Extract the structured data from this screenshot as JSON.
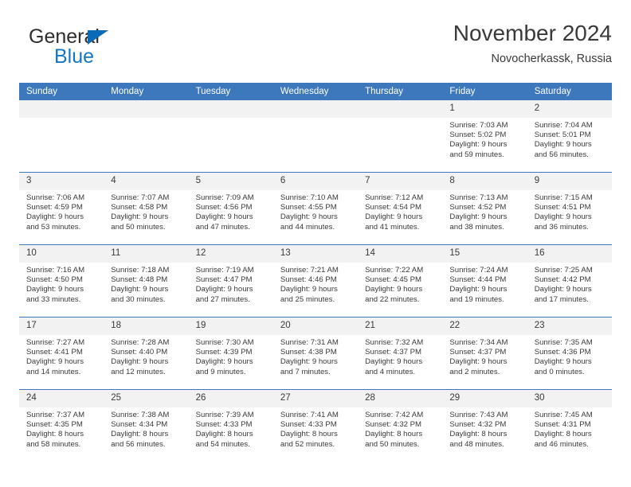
{
  "brand": {
    "line1": "General",
    "line2": "Blue",
    "triangle_color": "#0a6ab5",
    "text_color": "#2e2e2e",
    "accent_color": "#1577c4"
  },
  "header": {
    "title": "November 2024",
    "subtitle": "Novocherkassk, Russia"
  },
  "theme": {
    "header_bg": "#3d77bc",
    "header_text": "#ffffff",
    "daynum_bg": "#f2f2f2",
    "cell_bg": "#ffffff",
    "text": "#3a3a3a"
  },
  "weekdays": [
    "Sunday",
    "Monday",
    "Tuesday",
    "Wednesday",
    "Thursday",
    "Friday",
    "Saturday"
  ],
  "weeks": [
    [
      {
        "empty": true
      },
      {
        "empty": true
      },
      {
        "empty": true
      },
      {
        "empty": true
      },
      {
        "empty": true
      },
      {
        "day": "1",
        "sunrise": "Sunrise: 7:03 AM",
        "sunset": "Sunset: 5:02 PM",
        "daylight1": "Daylight: 9 hours",
        "daylight2": "and 59 minutes."
      },
      {
        "day": "2",
        "sunrise": "Sunrise: 7:04 AM",
        "sunset": "Sunset: 5:01 PM",
        "daylight1": "Daylight: 9 hours",
        "daylight2": "and 56 minutes."
      }
    ],
    [
      {
        "day": "3",
        "sunrise": "Sunrise: 7:06 AM",
        "sunset": "Sunset: 4:59 PM",
        "daylight1": "Daylight: 9 hours",
        "daylight2": "and 53 minutes."
      },
      {
        "day": "4",
        "sunrise": "Sunrise: 7:07 AM",
        "sunset": "Sunset: 4:58 PM",
        "daylight1": "Daylight: 9 hours",
        "daylight2": "and 50 minutes."
      },
      {
        "day": "5",
        "sunrise": "Sunrise: 7:09 AM",
        "sunset": "Sunset: 4:56 PM",
        "daylight1": "Daylight: 9 hours",
        "daylight2": "and 47 minutes."
      },
      {
        "day": "6",
        "sunrise": "Sunrise: 7:10 AM",
        "sunset": "Sunset: 4:55 PM",
        "daylight1": "Daylight: 9 hours",
        "daylight2": "and 44 minutes."
      },
      {
        "day": "7",
        "sunrise": "Sunrise: 7:12 AM",
        "sunset": "Sunset: 4:54 PM",
        "daylight1": "Daylight: 9 hours",
        "daylight2": "and 41 minutes."
      },
      {
        "day": "8",
        "sunrise": "Sunrise: 7:13 AM",
        "sunset": "Sunset: 4:52 PM",
        "daylight1": "Daylight: 9 hours",
        "daylight2": "and 38 minutes."
      },
      {
        "day": "9",
        "sunrise": "Sunrise: 7:15 AM",
        "sunset": "Sunset: 4:51 PM",
        "daylight1": "Daylight: 9 hours",
        "daylight2": "and 36 minutes."
      }
    ],
    [
      {
        "day": "10",
        "sunrise": "Sunrise: 7:16 AM",
        "sunset": "Sunset: 4:50 PM",
        "daylight1": "Daylight: 9 hours",
        "daylight2": "and 33 minutes."
      },
      {
        "day": "11",
        "sunrise": "Sunrise: 7:18 AM",
        "sunset": "Sunset: 4:48 PM",
        "daylight1": "Daylight: 9 hours",
        "daylight2": "and 30 minutes."
      },
      {
        "day": "12",
        "sunrise": "Sunrise: 7:19 AM",
        "sunset": "Sunset: 4:47 PM",
        "daylight1": "Daylight: 9 hours",
        "daylight2": "and 27 minutes."
      },
      {
        "day": "13",
        "sunrise": "Sunrise: 7:21 AM",
        "sunset": "Sunset: 4:46 PM",
        "daylight1": "Daylight: 9 hours",
        "daylight2": "and 25 minutes."
      },
      {
        "day": "14",
        "sunrise": "Sunrise: 7:22 AM",
        "sunset": "Sunset: 4:45 PM",
        "daylight1": "Daylight: 9 hours",
        "daylight2": "and 22 minutes."
      },
      {
        "day": "15",
        "sunrise": "Sunrise: 7:24 AM",
        "sunset": "Sunset: 4:44 PM",
        "daylight1": "Daylight: 9 hours",
        "daylight2": "and 19 minutes."
      },
      {
        "day": "16",
        "sunrise": "Sunrise: 7:25 AM",
        "sunset": "Sunset: 4:42 PM",
        "daylight1": "Daylight: 9 hours",
        "daylight2": "and 17 minutes."
      }
    ],
    [
      {
        "day": "17",
        "sunrise": "Sunrise: 7:27 AM",
        "sunset": "Sunset: 4:41 PM",
        "daylight1": "Daylight: 9 hours",
        "daylight2": "and 14 minutes."
      },
      {
        "day": "18",
        "sunrise": "Sunrise: 7:28 AM",
        "sunset": "Sunset: 4:40 PM",
        "daylight1": "Daylight: 9 hours",
        "daylight2": "and 12 minutes."
      },
      {
        "day": "19",
        "sunrise": "Sunrise: 7:30 AM",
        "sunset": "Sunset: 4:39 PM",
        "daylight1": "Daylight: 9 hours",
        "daylight2": "and 9 minutes."
      },
      {
        "day": "20",
        "sunrise": "Sunrise: 7:31 AM",
        "sunset": "Sunset: 4:38 PM",
        "daylight1": "Daylight: 9 hours",
        "daylight2": "and 7 minutes."
      },
      {
        "day": "21",
        "sunrise": "Sunrise: 7:32 AM",
        "sunset": "Sunset: 4:37 PM",
        "daylight1": "Daylight: 9 hours",
        "daylight2": "and 4 minutes."
      },
      {
        "day": "22",
        "sunrise": "Sunrise: 7:34 AM",
        "sunset": "Sunset: 4:37 PM",
        "daylight1": "Daylight: 9 hours",
        "daylight2": "and 2 minutes."
      },
      {
        "day": "23",
        "sunrise": "Sunrise: 7:35 AM",
        "sunset": "Sunset: 4:36 PM",
        "daylight1": "Daylight: 9 hours",
        "daylight2": "and 0 minutes."
      }
    ],
    [
      {
        "day": "24",
        "sunrise": "Sunrise: 7:37 AM",
        "sunset": "Sunset: 4:35 PM",
        "daylight1": "Daylight: 8 hours",
        "daylight2": "and 58 minutes."
      },
      {
        "day": "25",
        "sunrise": "Sunrise: 7:38 AM",
        "sunset": "Sunset: 4:34 PM",
        "daylight1": "Daylight: 8 hours",
        "daylight2": "and 56 minutes."
      },
      {
        "day": "26",
        "sunrise": "Sunrise: 7:39 AM",
        "sunset": "Sunset: 4:33 PM",
        "daylight1": "Daylight: 8 hours",
        "daylight2": "and 54 minutes."
      },
      {
        "day": "27",
        "sunrise": "Sunrise: 7:41 AM",
        "sunset": "Sunset: 4:33 PM",
        "daylight1": "Daylight: 8 hours",
        "daylight2": "and 52 minutes."
      },
      {
        "day": "28",
        "sunrise": "Sunrise: 7:42 AM",
        "sunset": "Sunset: 4:32 PM",
        "daylight1": "Daylight: 8 hours",
        "daylight2": "and 50 minutes."
      },
      {
        "day": "29",
        "sunrise": "Sunrise: 7:43 AM",
        "sunset": "Sunset: 4:32 PM",
        "daylight1": "Daylight: 8 hours",
        "daylight2": "and 48 minutes."
      },
      {
        "day": "30",
        "sunrise": "Sunrise: 7:45 AM",
        "sunset": "Sunset: 4:31 PM",
        "daylight1": "Daylight: 8 hours",
        "daylight2": "and 46 minutes."
      }
    ]
  ]
}
